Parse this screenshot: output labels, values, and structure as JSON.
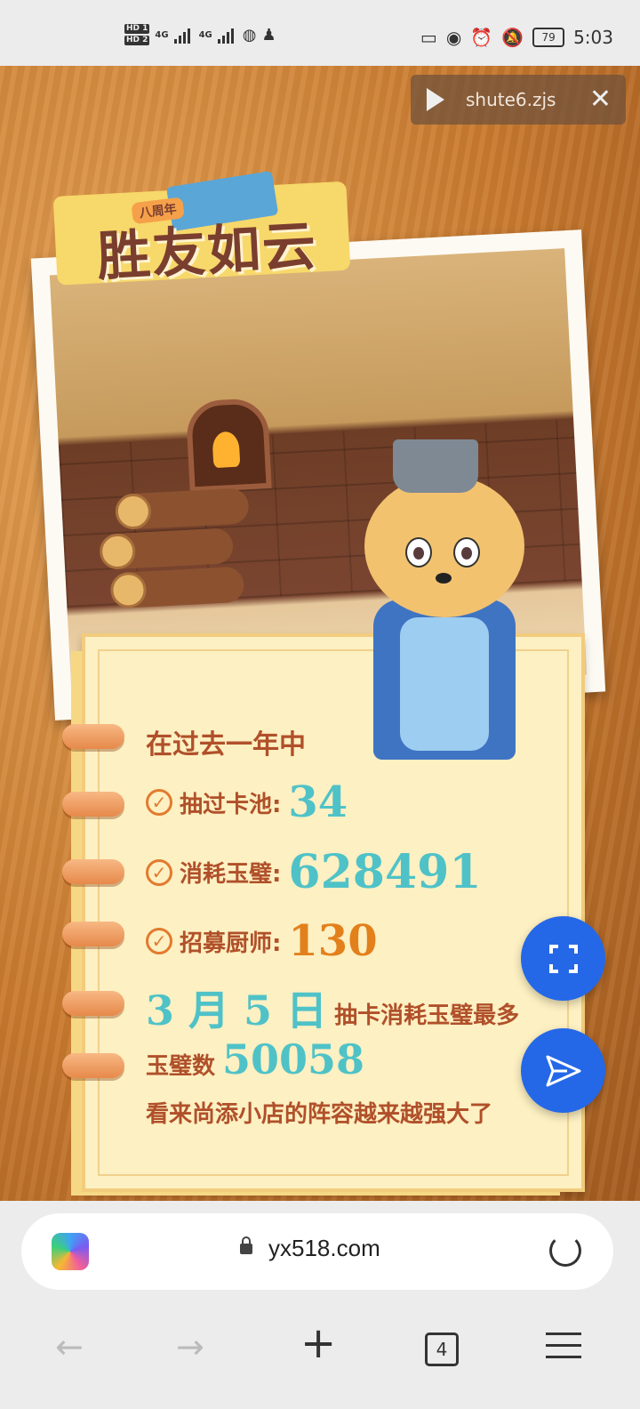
{
  "status_bar": {
    "hd1": "HD 1",
    "hd2": "HD 2",
    "net1": "4G",
    "net2": "4G",
    "battery": "79",
    "time": "5:03"
  },
  "toast": {
    "filename": "shute6.zjs",
    "close": "✕"
  },
  "badge": {
    "sub": "八周年",
    "title": "胜友如云"
  },
  "stats": {
    "intro": "在过去一年中",
    "draw_label": "抽过卡池:",
    "draw_value": "34",
    "spend_label": "消耗玉璧:",
    "spend_value": "628491",
    "recruit_label": "招募厨师:",
    "recruit_value": "130",
    "date_value": "3 月 5 日",
    "date_suffix": "抽卡消耗玉璧最多",
    "jade_label": "玉璧数",
    "jade_value": "50058",
    "closing": "看来尚添小店的阵容越来越强大了",
    "check": "✓"
  },
  "browser": {
    "url": "yx518.com",
    "tab_count": "4",
    "back": "←",
    "forward": "→",
    "new_tab": "+"
  },
  "colors": {
    "accent_blue": "#2468e8",
    "teal_number": "#4fc2c8",
    "orange_number": "#e2801c",
    "label_brown": "#b0502a"
  }
}
